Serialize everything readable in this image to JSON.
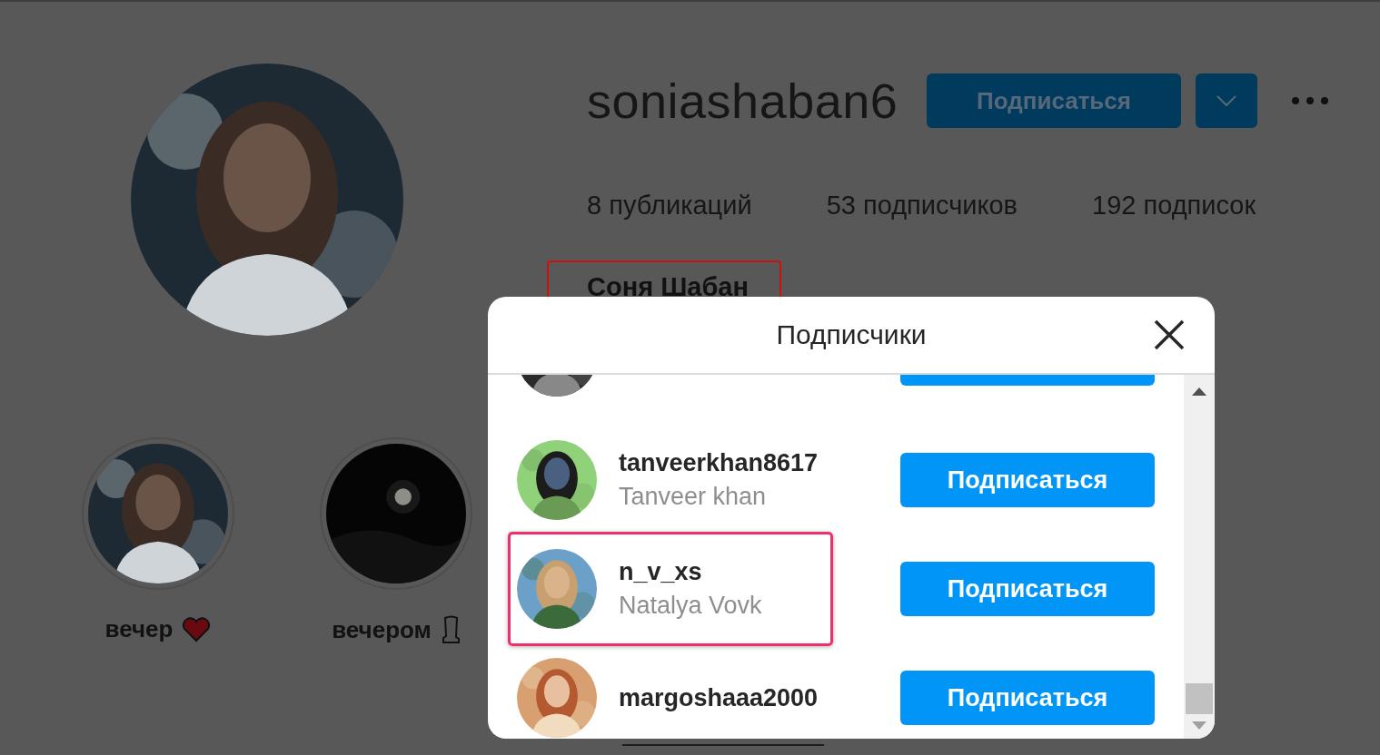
{
  "profile": {
    "username": "soniashaban6",
    "follow_button": "Подписаться",
    "stats": [
      {
        "count": "8",
        "label": "публикаций"
      },
      {
        "count": "53",
        "label": "подписчиков"
      },
      {
        "count": "192",
        "label": "подписок"
      }
    ],
    "full_name": "Соня Шабан",
    "name_highlighted": true
  },
  "highlights": [
    {
      "label": "вечер"
    },
    {
      "label": "вечером"
    }
  ],
  "modal": {
    "title": "Подписчики",
    "followers": [
      {
        "kind": "clipped",
        "highlighted": false
      },
      {
        "kind": "full",
        "username": "tanveerkhan8617",
        "name": "Tanveer khan",
        "button": "Подписаться",
        "highlighted": false
      },
      {
        "kind": "full",
        "username": "n_v_xs",
        "name": "Natalya Vovk",
        "button": "Подписаться",
        "highlighted": true
      },
      {
        "kind": "full",
        "username": "margoshaaa2000",
        "button": "Подписаться",
        "highlighted": false
      }
    ]
  }
}
